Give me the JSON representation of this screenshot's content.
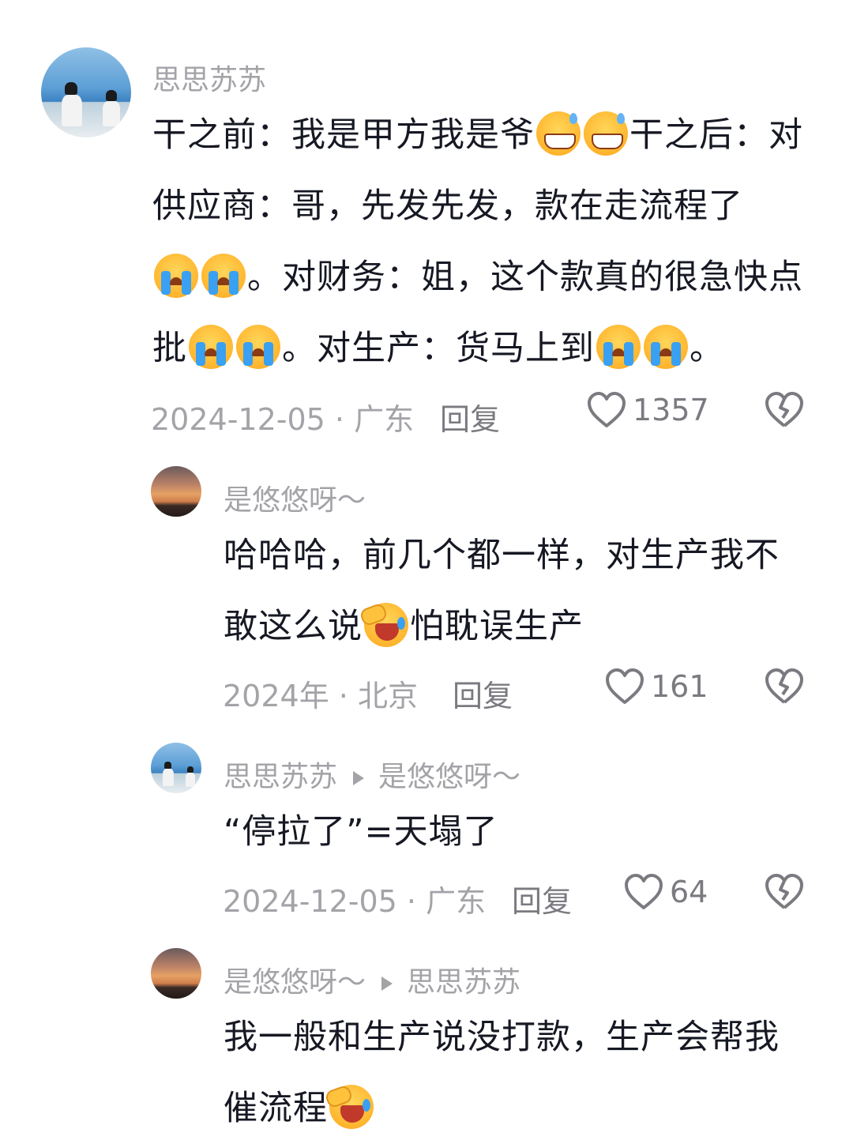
{
  "comments": [
    {
      "name": "思思苏苏",
      "text_parts": [
        "干之前：我是甲方我是爷",
        "干之后：对供应商：哥，先发先发，款在走流程了",
        "。对财务：姐，这个款真的很急快点批",
        "。对生产：货马上到",
        "。"
      ],
      "meta": "2024-12-05 · 广东",
      "reply_label": "回复",
      "likes": "1357"
    },
    {
      "name": "是悠悠呀～",
      "text_parts": [
        "哈哈哈，前几个都一样，对生产我不敢这么说",
        "怕耽误生产"
      ],
      "meta": "2024年 · 北京",
      "reply_label": "回复",
      "likes": "161"
    },
    {
      "name": "思思苏苏",
      "reply_to": "是悠悠呀～",
      "text_parts": [
        "“停拉了”=天塌了"
      ],
      "meta": "2024-12-05 · 广东",
      "reply_label": "回复",
      "likes": "64"
    },
    {
      "name": "是悠悠呀～",
      "reply_to": "思思苏苏",
      "text_parts": [
        "我一般和生产说没打款，生产会帮我催流程"
      ]
    }
  ],
  "icons": {
    "like": "heart-outline-icon",
    "dislike": "broken-heart-icon",
    "reply_arrow": "play-triangle-icon"
  },
  "colors": {
    "text": "#161823",
    "meta": "#a3a3a8",
    "action": "#7a7a80"
  }
}
